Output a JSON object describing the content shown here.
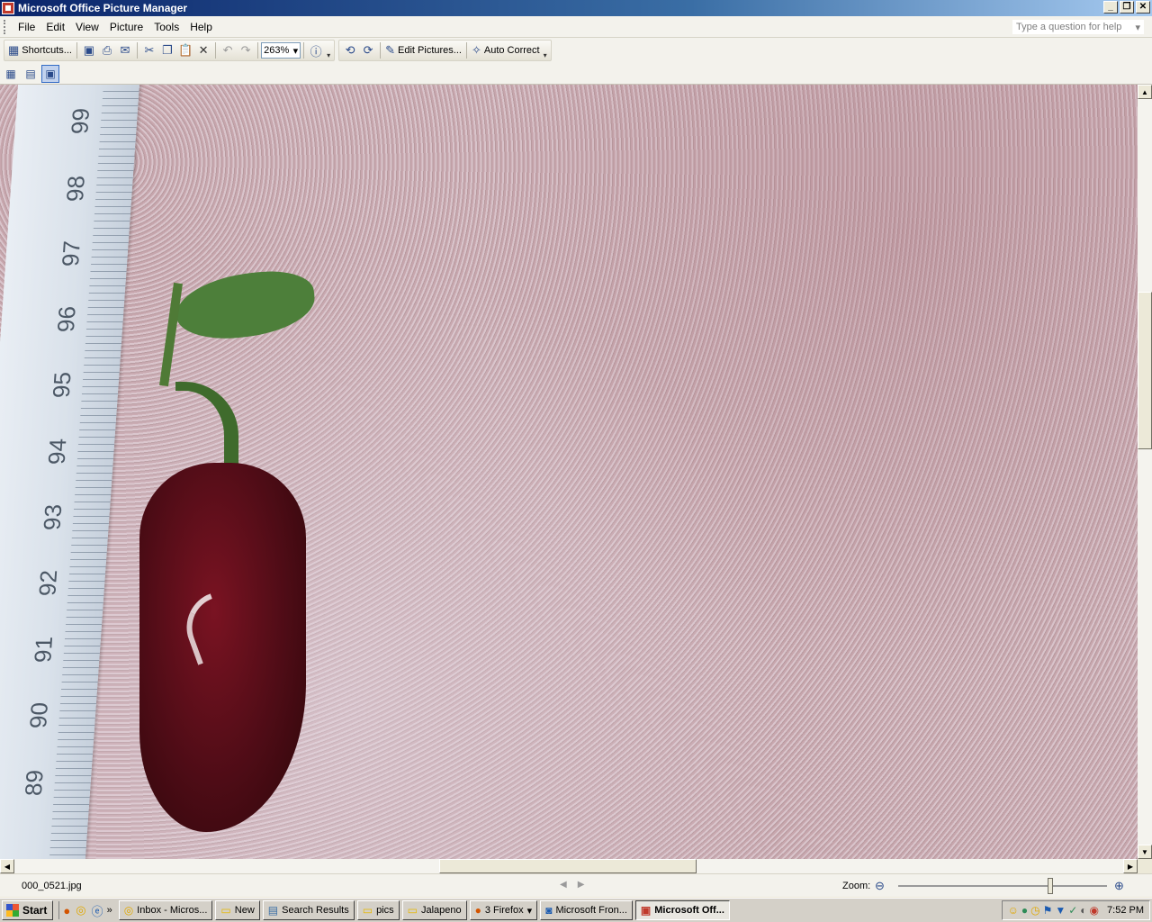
{
  "window": {
    "title": "Microsoft Office Picture Manager",
    "controls": [
      "_",
      "❐",
      "✕"
    ]
  },
  "menu": {
    "items": [
      {
        "label": "File",
        "key": "F"
      },
      {
        "label": "Edit",
        "key": "E"
      },
      {
        "label": "View",
        "key": "V"
      },
      {
        "label": "Picture",
        "key": "P"
      },
      {
        "label": "Tools",
        "key": "T"
      },
      {
        "label": "Help",
        "key": "H"
      }
    ],
    "help_placeholder": "Type a question for help"
  },
  "toolbar": {
    "shortcuts_label": "Shortcuts...",
    "zoom_value": "263%",
    "edit_pictures_label": "Edit Pictures...",
    "auto_correct_label": "Auto Correct"
  },
  "picture": {
    "ruler_numbers": [
      "99",
      "98",
      "97",
      "96",
      "95",
      "94",
      "93",
      "92",
      "91",
      "90",
      "89"
    ]
  },
  "status": {
    "filename": "000_0521.jpg",
    "zoom_label": "Zoom:",
    "zoom_level_fraction": 0.73
  },
  "taskbar": {
    "start_label": "Start",
    "tasks": [
      {
        "label": "Inbox - Micros...",
        "icon": "outlook-icon"
      },
      {
        "label": "New",
        "icon": "folder-icon"
      },
      {
        "label": "Search Results",
        "icon": "search-results-icon"
      },
      {
        "label": "pics",
        "icon": "folder-icon"
      },
      {
        "label": "Jalapeno",
        "icon": "folder-icon"
      },
      {
        "label": "3 Firefox",
        "icon": "firefox-icon"
      },
      {
        "label": "Microsoft Fron...",
        "icon": "frontpage-icon"
      },
      {
        "label": "Microsoft Off...",
        "icon": "picture-manager-icon",
        "active": true
      }
    ],
    "clock": "7:52 PM"
  }
}
